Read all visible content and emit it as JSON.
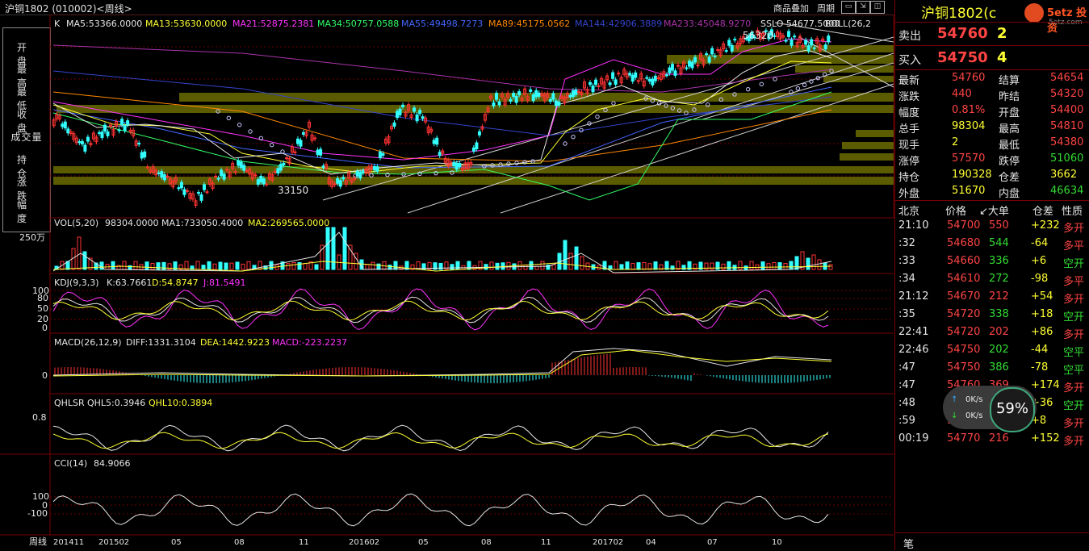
{
  "window": {
    "title": "沪铜1802 (010002)<周线>",
    "buttons": [
      "商品叠加",
      "周期"
    ]
  },
  "left_panel": {
    "items": [
      "开 盘",
      "最 高",
      "最 低",
      "收 盘",
      "成交量",
      "持 仓",
      "涨 跌",
      "幅 度"
    ]
  },
  "main": {
    "k_label": "K",
    "ma": [
      {
        "text": "MA5:53366.0000",
        "color": "#e6e6e6"
      },
      {
        "text": "MA13:53630.0000",
        "color": "#ffff33"
      },
      {
        "text": "MA21:52875.2381",
        "color": "#ff33ff"
      },
      {
        "text": "MA34:50757.0588",
        "color": "#33ff66"
      },
      {
        "text": "MA55:49498.7273",
        "color": "#4466ff"
      },
      {
        "text": "MA89:45175.0562",
        "color": "#ff8800"
      },
      {
        "text": "MA144:42906.3889",
        "color": "#3344cc"
      },
      {
        "text": "MA233:45048.9270",
        "color": "#aa33aa"
      },
      {
        "text": "SSLO  54677.5000",
        "color": "#e6e6e6"
      },
      {
        "text": "BOLL(26,2",
        "color": "#e6e6e6"
      }
    ],
    "annot_high": "56320",
    "annot_low": "33150"
  },
  "vol": {
    "label": "VOL(5,20)",
    "v1": "98304.0000",
    "ma1": "MA1:733050.4000",
    "ma2": "MA2:269565.0000",
    "scale": "250万"
  },
  "kdj": {
    "label": "KDJ(9,3,3)",
    "k": "K:63.7661",
    "d": "D:54.8747",
    "j": "J:81.5491",
    "ticks": [
      "100",
      "80",
      "50",
      "20",
      "0"
    ]
  },
  "macd": {
    "label": "MACD(26,12,9)",
    "diff": "DIFF:1331.3104",
    "dea": "DEA:1442.9223",
    "macd": "MACD:-223.2237",
    "zero": "0"
  },
  "qhlsr": {
    "label": "QHLSR",
    "q5": "QHL5:0.3946",
    "q10": "QHL10:0.3894",
    "tick": "0.8"
  },
  "cci": {
    "label": "CCI(14)",
    "val": "84.9066",
    "ticks": [
      "100",
      "0",
      "-100"
    ]
  },
  "xaxis": {
    "name": "周线",
    "labels": [
      "201411",
      "201502",
      "05",
      "08",
      "11",
      "201602",
      "05",
      "08",
      "11",
      "201702",
      "04",
      "07",
      "10"
    ]
  },
  "quote": {
    "name": "沪铜1802(c",
    "brand": "5etz 投资",
    "brand_site": "5etz.com",
    "sell_label": "卖出",
    "sell_price": "54760",
    "sell_vol": "2",
    "buy_label": "买入",
    "buy_price": "54750",
    "buy_vol": "4",
    "rows": [
      [
        "最新",
        "54760",
        "结算",
        "54654"
      ],
      [
        "涨跌",
        "440",
        "昨结",
        "54320"
      ],
      [
        "幅度",
        "0.81%",
        "开盘",
        "54400"
      ],
      [
        "总手",
        "98304",
        "最高",
        "54810"
      ],
      [
        "现手",
        "2",
        "最低",
        "54380"
      ],
      [
        "涨停",
        "57570",
        "跌停",
        "51060"
      ],
      [
        "持仓",
        "190328",
        "仓差",
        "3662"
      ],
      [
        "外盘",
        "51670",
        "内盘",
        "46634"
      ]
    ],
    "tick_header": [
      "北京",
      "价格",
      "↙大单",
      "仓差",
      "性质"
    ],
    "ticks": [
      [
        "21:10",
        "54700",
        "550",
        "+232",
        "多开"
      ],
      [
        ":32",
        "54680",
        "544",
        "-64",
        "多平"
      ],
      [
        ":33",
        "54660",
        "336",
        "+6",
        "空开"
      ],
      [
        ":34",
        "54610",
        "272",
        "-98",
        "多平"
      ],
      [
        "21:12",
        "54670",
        "212",
        "+54",
        "多开"
      ],
      [
        ":35",
        "54720",
        "338",
        "+18",
        "空开"
      ],
      [
        "22:41",
        "54720",
        "202",
        "+86",
        "多开"
      ],
      [
        "22:46",
        "54750",
        "202",
        "-44",
        "空平"
      ],
      [
        ":47",
        "54750",
        "386",
        "-78",
        "空平"
      ],
      [
        ":47",
        "54760",
        "369",
        "+174",
        "多开"
      ],
      [
        ":48",
        "54750",
        "222",
        "+36",
        "空开"
      ],
      [
        ":59",
        "54760",
        "222",
        "+8",
        "多开"
      ],
      [
        "00:19",
        "54770",
        "216",
        "+152",
        "多开"
      ]
    ],
    "speed": {
      "up": "0K/s",
      "down": "0K/s",
      "pct": "59%"
    },
    "footer": "笔"
  },
  "chart_data": {
    "type": "candlestick",
    "title": "沪铜1802 周线",
    "x": [
      "201411",
      "201502",
      "05",
      "08",
      "11",
      "201602",
      "05",
      "08",
      "11",
      "201702",
      "04",
      "07",
      "10"
    ],
    "close": [
      44500,
      41000,
      43000,
      44000,
      38000,
      36500,
      34000,
      37000,
      38500,
      36000,
      39000,
      43500,
      36000,
      37000,
      38500,
      46000,
      45000,
      39000,
      38000,
      47000,
      47500,
      48000,
      47000,
      48500,
      49500,
      50500,
      49500,
      51000,
      52000,
      53500,
      55000,
      56000,
      55500,
      54300,
      54760
    ],
    "highs_lows": {
      "high": 56320,
      "low": 33150
    },
    "ylim": [
      32000,
      58000
    ]
  }
}
